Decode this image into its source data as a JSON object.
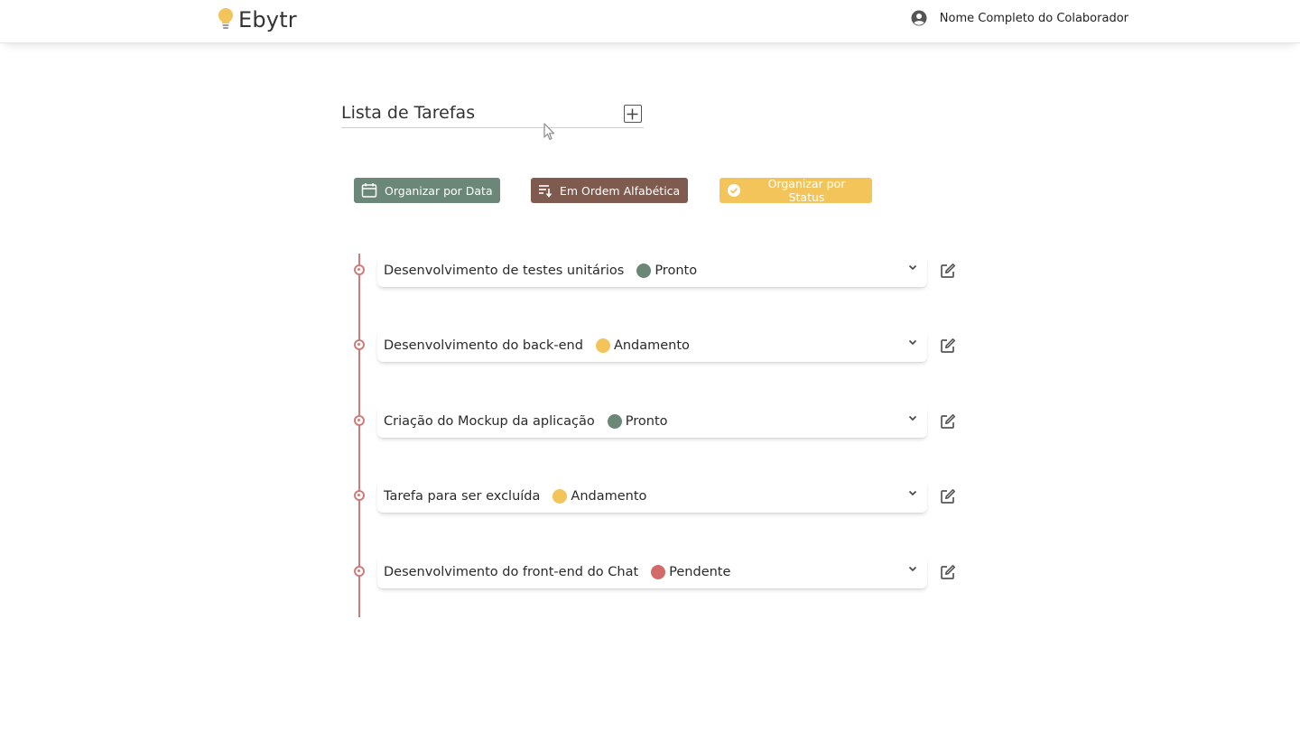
{
  "header": {
    "brand": "Ebytr",
    "user_name": "Nome Completo do Colaborador"
  },
  "main": {
    "title": "Lista de Tarefas"
  },
  "sort_buttons": [
    {
      "label": "Organizar por Data",
      "color": "#6b8778",
      "icon": "calendar-icon"
    },
    {
      "label": "Em Ordem Alfabética",
      "color": "#7f5b4f",
      "icon": "sort-alpha-icon"
    },
    {
      "label": "Organizar por Status",
      "color": "#f2c45a",
      "icon": "check-circle-icon"
    }
  ],
  "colors": {
    "timeline": "#d07b7b",
    "pronto": "#6b8778",
    "andamento": "#f2c45a",
    "pendente": "#d26a6a"
  },
  "tasks": [
    {
      "name": "Desenvolvimento de testes unitários",
      "status": "Pronto",
      "status_color": "#6b8778"
    },
    {
      "name": "Desenvolvimento do back-end",
      "status": "Andamento",
      "status_color": "#f2c45a"
    },
    {
      "name": "Criação do Mockup da aplicação",
      "status": "Pronto",
      "status_color": "#6b8778"
    },
    {
      "name": "Tarefa para ser excluída",
      "status": "Andamento",
      "status_color": "#f2c45a"
    },
    {
      "name": "Desenvolvimento do front-end do Chat",
      "status": "Pendente",
      "status_color": "#d26a6a"
    }
  ]
}
